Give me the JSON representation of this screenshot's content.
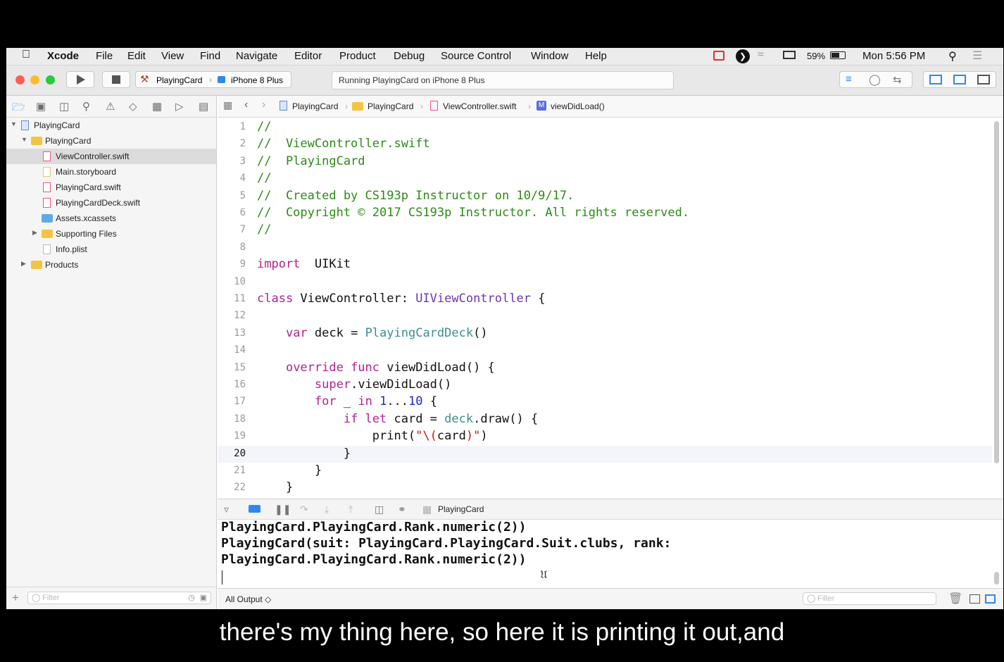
{
  "menubar": {
    "app_name": "Xcode",
    "items": [
      "File",
      "Edit",
      "View",
      "Find",
      "Navigate",
      "Editor",
      "Product",
      "Debug",
      "Source Control",
      "Window",
      "Help"
    ],
    "battery": "59%",
    "clock": "Mon 5:56 PM"
  },
  "toolbar": {
    "scheme_target": "PlayingCard",
    "scheme_device": "iPhone 8 Plus",
    "activity_status": "Running PlayingCard on iPhone 8 Plus"
  },
  "navigator": {
    "tree": [
      {
        "label": "PlayingCard",
        "kind": "project",
        "depth": 0,
        "expanded": true
      },
      {
        "label": "PlayingCard",
        "kind": "folder",
        "depth": 1,
        "expanded": true
      },
      {
        "label": "ViewController.swift",
        "kind": "swift",
        "depth": 2,
        "selected": true
      },
      {
        "label": "Main.storyboard",
        "kind": "storyboard",
        "depth": 2
      },
      {
        "label": "PlayingCard.swift",
        "kind": "swift",
        "depth": 2
      },
      {
        "label": "PlayingCardDeck.swift",
        "kind": "swift",
        "depth": 2
      },
      {
        "label": "Assets.xcassets",
        "kind": "assets",
        "depth": 2
      },
      {
        "label": "Supporting Files",
        "kind": "folder",
        "depth": 2,
        "expanded": false
      },
      {
        "label": "Info.plist",
        "kind": "plist",
        "depth": 2
      },
      {
        "label": "Products",
        "kind": "folder",
        "depth": 1,
        "expanded": false
      }
    ],
    "filter_placeholder": "Filter"
  },
  "jumpbar": {
    "crumbs": [
      "PlayingCard",
      "PlayingCard",
      "ViewController.swift",
      "viewDidLoad()"
    ]
  },
  "editor": {
    "current_line": 20,
    "lines": [
      {
        "n": "1",
        "parts": [
          [
            "cm",
            "//"
          ]
        ]
      },
      {
        "n": "2",
        "parts": [
          [
            "cm",
            "//  ViewController.swift"
          ]
        ]
      },
      {
        "n": "3",
        "parts": [
          [
            "cm",
            "//  PlayingCard"
          ]
        ]
      },
      {
        "n": "4",
        "parts": [
          [
            "cm",
            "//"
          ]
        ]
      },
      {
        "n": "5",
        "parts": [
          [
            "cm",
            "//  Created by CS193p Instructor on 10/9/17."
          ]
        ]
      },
      {
        "n": "6",
        "parts": [
          [
            "cm",
            "//  Copyright © 2017 CS193p Instructor. All rights reserved."
          ]
        ]
      },
      {
        "n": "7",
        "parts": [
          [
            "cm",
            "//"
          ]
        ]
      },
      {
        "n": "8",
        "parts": []
      },
      {
        "n": "9",
        "parts": [
          [
            "kw",
            "import"
          ],
          [
            "",
            "  UIKit"
          ]
        ]
      },
      {
        "n": "10",
        "parts": []
      },
      {
        "n": "11",
        "parts": [
          [
            "kw",
            "class"
          ],
          [
            "",
            " ViewController: "
          ],
          [
            "ty",
            "UIViewController"
          ],
          [
            "",
            " {"
          ]
        ]
      },
      {
        "n": "12",
        "parts": []
      },
      {
        "n": "13",
        "parts": [
          [
            "",
            "    "
          ],
          [
            "kw",
            "var"
          ],
          [
            "",
            " deck = "
          ],
          [
            "pr",
            "PlayingCardDeck"
          ],
          [
            "",
            "()"
          ]
        ]
      },
      {
        "n": "14",
        "parts": []
      },
      {
        "n": "15",
        "parts": [
          [
            "",
            "    "
          ],
          [
            "kw",
            "override func"
          ],
          [
            "",
            " viewDidLoad() {"
          ]
        ]
      },
      {
        "n": "16",
        "parts": [
          [
            "",
            "        "
          ],
          [
            "kw",
            "super"
          ],
          [
            "",
            ".viewDidLoad()"
          ]
        ]
      },
      {
        "n": "17",
        "parts": [
          [
            "",
            "        "
          ],
          [
            "kw",
            "for"
          ],
          [
            "",
            " _ "
          ],
          [
            "kw",
            "in"
          ],
          [
            "",
            " "
          ],
          [
            "nu",
            "1"
          ],
          [
            "",
            "..."
          ],
          [
            "nu",
            "10"
          ],
          [
            "",
            " {"
          ]
        ]
      },
      {
        "n": "18",
        "parts": [
          [
            "",
            "            "
          ],
          [
            "kw",
            "if let"
          ],
          [
            "",
            " card = "
          ],
          [
            "pr",
            "deck"
          ],
          [
            "",
            ".draw() {"
          ]
        ]
      },
      {
        "n": "19",
        "parts": [
          [
            "",
            "                print("
          ],
          [
            "st",
            "\"\\("
          ],
          [
            "",
            "card"
          ],
          [
            "st",
            ")\""
          ],
          [
            "",
            ")"
          ]
        ]
      },
      {
        "n": "20",
        "parts": [
          [
            "",
            "            }"
          ]
        ]
      },
      {
        "n": "21",
        "parts": [
          [
            "",
            "        }"
          ]
        ]
      },
      {
        "n": "22",
        "parts": [
          [
            "",
            "    }"
          ]
        ]
      }
    ]
  },
  "debugbar": {
    "target": "PlayingCard"
  },
  "console": {
    "lines": [
      "PlayingCard.PlayingCard.Rank.numeric(2))",
      "PlayingCard(suit: PlayingCard.PlayingCard.Suit.clubs, rank:",
      "PlayingCard.PlayingCard.Rank.numeric(2))"
    ],
    "output_selector": "All Output ◇",
    "filter_placeholder": "Filter"
  },
  "subtitle": "there's my thing here, so here it is printing it out,and",
  "colors": {
    "comment": "#2e8a16",
    "keyword": "#b5208e",
    "type": "#6b35b1",
    "project_symbol": "#3f8c93",
    "number": "#2323cc",
    "string": "#c41a16",
    "accent": "#1a73e8"
  }
}
